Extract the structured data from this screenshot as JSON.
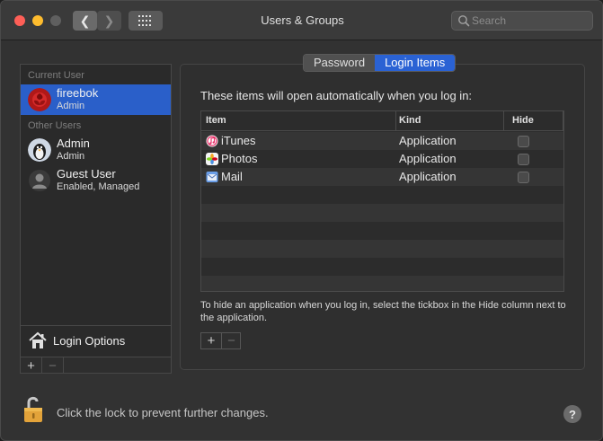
{
  "window": {
    "title": "Users & Groups"
  },
  "search": {
    "placeholder": "Search"
  },
  "sidebar": {
    "current_user_header": "Current User",
    "current_user": {
      "name": "fireebok",
      "role": "Admin"
    },
    "other_users_header": "Other Users",
    "other_users": [
      {
        "name": "Admin",
        "role": "Admin"
      },
      {
        "name": "Guest User",
        "role": "Enabled, Managed"
      }
    ],
    "login_options_label": "Login Options",
    "add_label": "+",
    "remove_label": "−"
  },
  "tabs": [
    {
      "label": "Password",
      "active": false
    },
    {
      "label": "Login Items",
      "active": true
    }
  ],
  "main": {
    "intro": "These items will open automatically when you log in:",
    "columns": {
      "item": "Item",
      "kind": "Kind",
      "hide": "Hide"
    },
    "rows": [
      {
        "item": "iTunes",
        "kind": "Application",
        "hide": false,
        "icon": "itunes-icon"
      },
      {
        "item": "Photos",
        "kind": "Application",
        "hide": false,
        "icon": "photos-icon"
      },
      {
        "item": "Mail",
        "kind": "Application",
        "hide": false,
        "icon": "mail-icon"
      }
    ],
    "hint": "To hide an application when you log in, select the tickbox in the Hide column next to the application.",
    "add_label": "+",
    "remove_label": "−"
  },
  "footer": {
    "lock_message": "Click the lock to prevent further changes.",
    "help_label": "?"
  }
}
